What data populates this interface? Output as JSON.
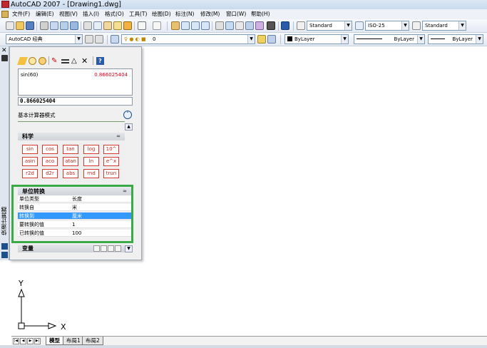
{
  "window": {
    "title": "AutoCAD 2007 - [Drawing1.dwg]"
  },
  "menu": [
    "文件(F)",
    "编辑(E)",
    "视图(V)",
    "插入(I)",
    "格式(O)",
    "工具(T)",
    "绘图(D)",
    "标注(N)",
    "修改(M)",
    "窗口(W)",
    "帮助(H)"
  ],
  "toolbar1": {
    "text_style": "Standard",
    "dim_style": "ISO-25",
    "table_style": "Standard"
  },
  "toolbar2": {
    "workspace": "AutoCAD 经典",
    "layer": "0",
    "color": "ByLayer",
    "linetype": "ByLayer",
    "lineweight": "ByLayer"
  },
  "palette": {
    "side_title": "快速计算器",
    "history_expr": "sin(60)",
    "history_result": "0.866025404",
    "input_value": "0.866025404",
    "mode_label": "基本计算器模式",
    "mode_button_icon": "collapse-up-icon",
    "science_title": "科学",
    "sci_keys": [
      "sin",
      "cos",
      "tan",
      "log",
      "10^",
      "asin",
      "aco",
      "atan",
      "ln",
      "e^x",
      "r2d",
      "d2r",
      "abs",
      "rnd",
      "trun"
    ],
    "unit_title": "单位转换",
    "unit_rows": [
      {
        "key": "单位类型",
        "value": "长度"
      },
      {
        "key": "转换自",
        "value": "米"
      },
      {
        "key": "转换到",
        "value": "厘米"
      },
      {
        "key": "要转换的值",
        "value": "1"
      },
      {
        "key": "已转换的值",
        "value": "100"
      }
    ],
    "variables_title": "变量"
  },
  "ucs": {
    "x_label": "X",
    "y_label": "Y"
  },
  "tabs": [
    "模型",
    "布局1",
    "布局2"
  ],
  "colors": {
    "highlight": "#3399ff",
    "unit_border": "#3aaa48",
    "result_red": "#e0001a",
    "key_red": "#d5392f"
  }
}
